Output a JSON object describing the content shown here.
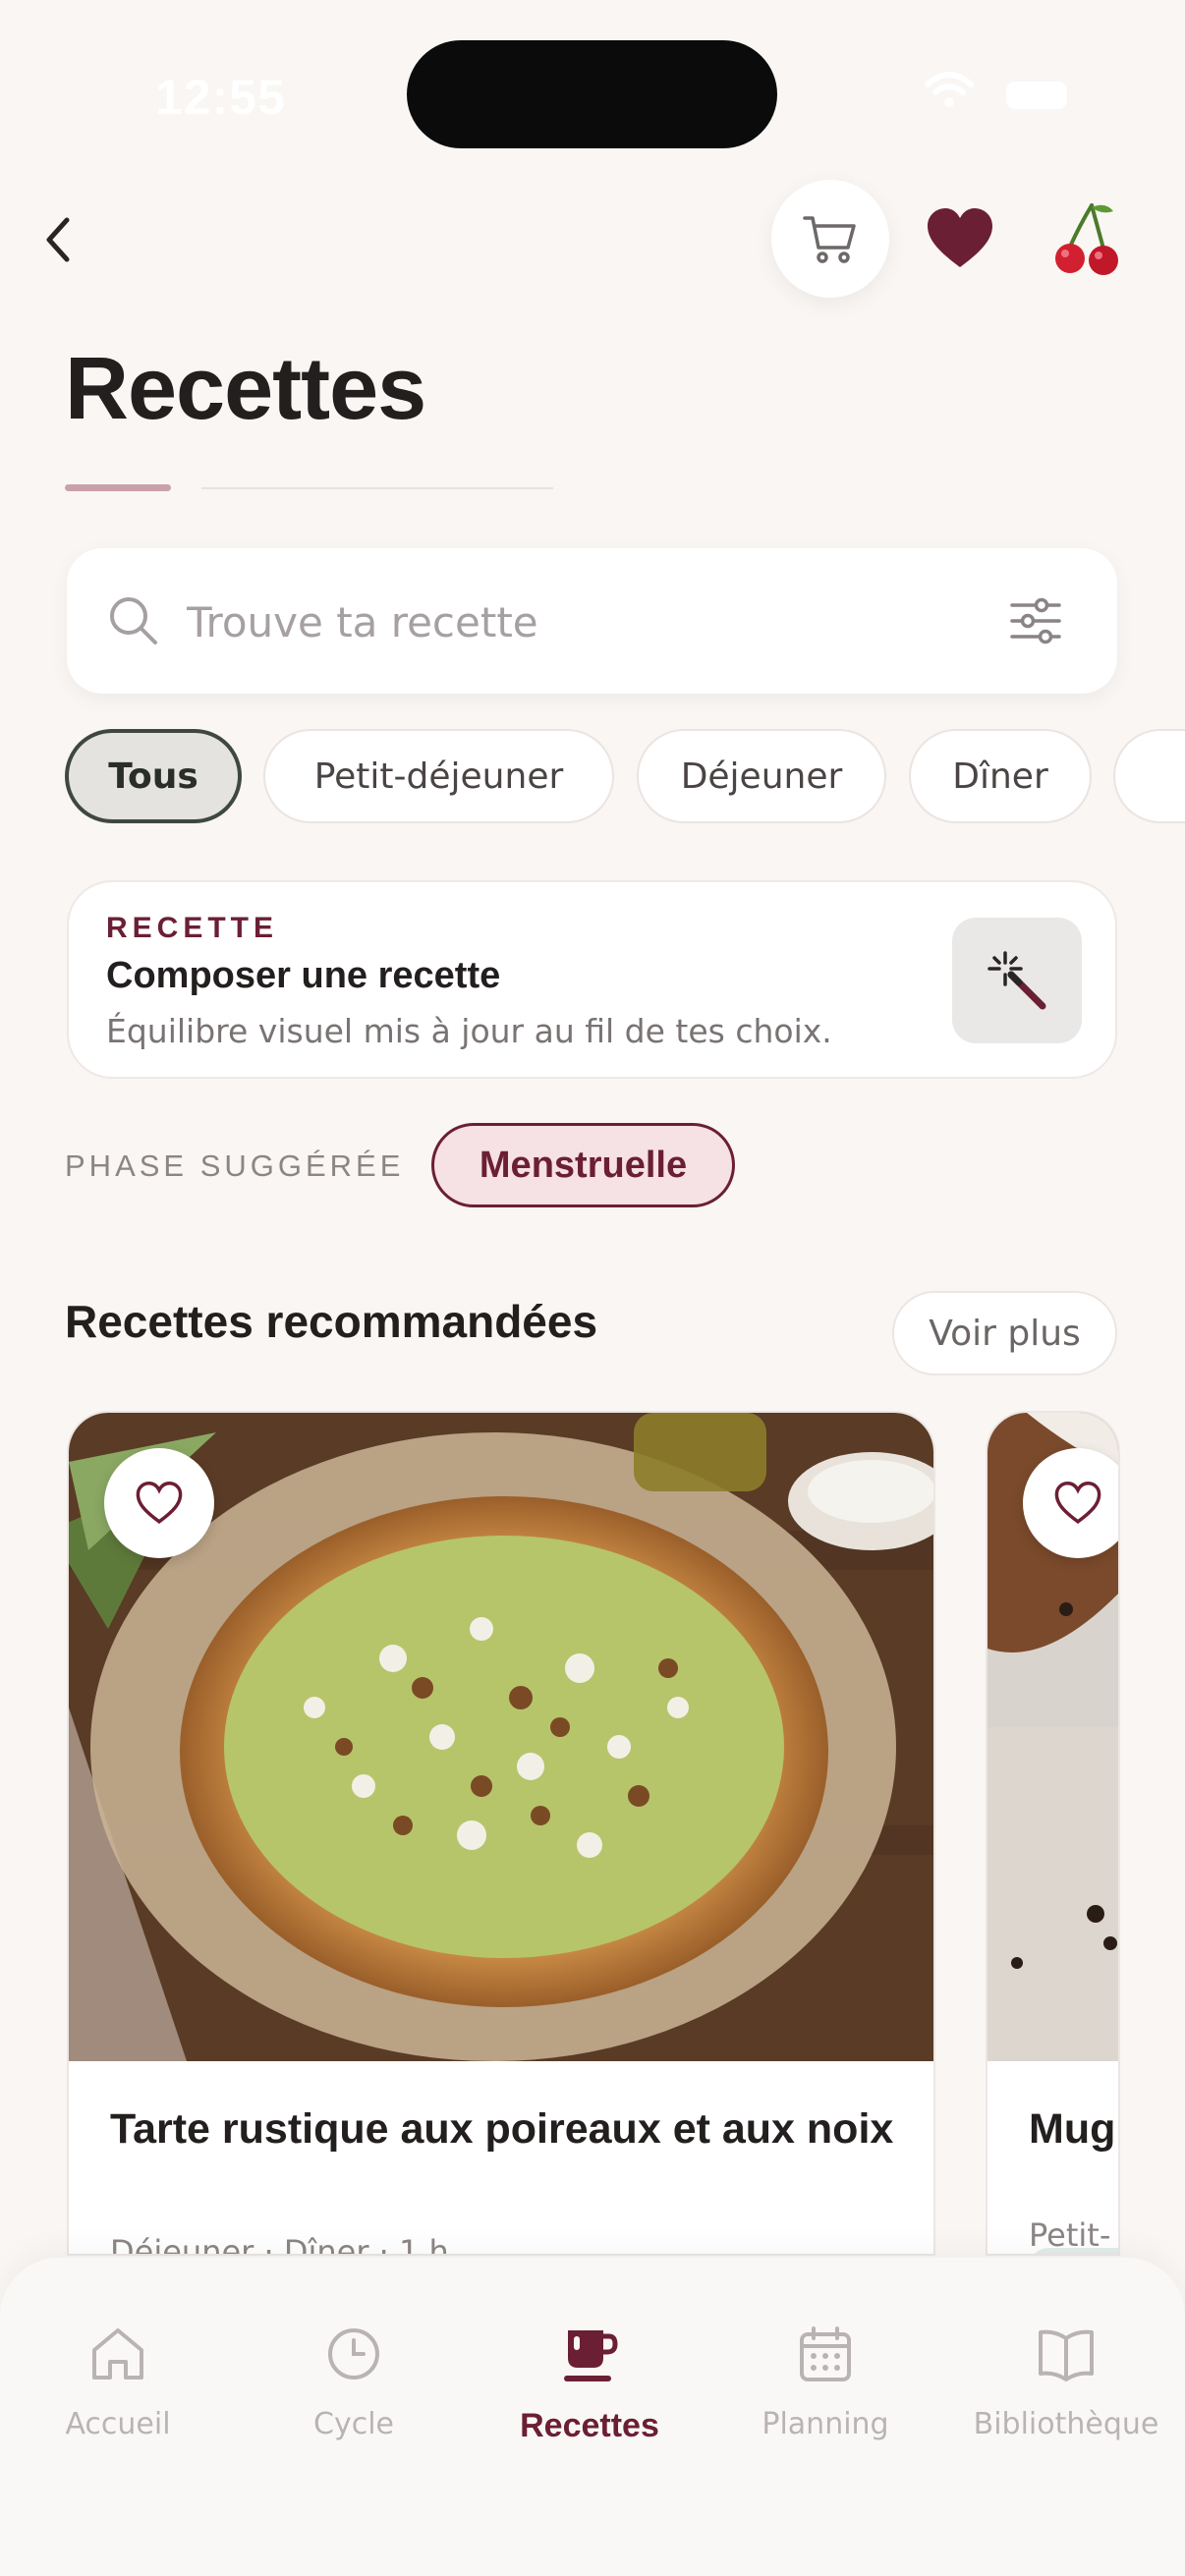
{
  "status_bar": {
    "time": "12:55"
  },
  "header": {
    "title": "Recettes"
  },
  "search": {
    "placeholder": "Trouve ta recette"
  },
  "filters": {
    "chips": [
      {
        "label": "Tous",
        "active": true
      },
      {
        "label": "Petit-déjeuner",
        "active": false
      },
      {
        "label": "Déjeuner",
        "active": false
      },
      {
        "label": "Dîner",
        "active": false
      }
    ]
  },
  "compose_card": {
    "kicker": "RECETTE",
    "title": "Composer une recette",
    "subtitle": "Équilibre visuel mis à jour au fil de tes choix."
  },
  "phase": {
    "label": "PHASE SUGGÉRÉE",
    "value": "Menstruelle"
  },
  "recommended": {
    "title": "Recettes recommandées",
    "see_more": "Voir plus",
    "cards": [
      {
        "title": "Tarte rustique aux poireaux et aux noix",
        "meta": "Déjeuner · Dîner · 1 h"
      },
      {
        "title": "Mug",
        "meta": "Petit-"
      }
    ]
  },
  "tabbar": {
    "tabs": [
      {
        "label": "Accueil",
        "icon": "home-icon",
        "active": false
      },
      {
        "label": "Cycle",
        "icon": "clock-icon",
        "active": false
      },
      {
        "label": "Recettes",
        "icon": "cup-icon",
        "active": true
      },
      {
        "label": "Planning",
        "icon": "calendar-icon",
        "active": false
      },
      {
        "label": "Bibliothèque",
        "icon": "book-icon",
        "active": false
      }
    ]
  },
  "colors": {
    "background": "#f9f6f3",
    "brand": "#6b1f34",
    "phase_chip_bg": "#f6e1e5",
    "active_chip_border": "#3f4742"
  }
}
